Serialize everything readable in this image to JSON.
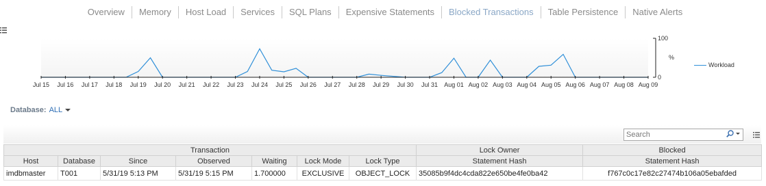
{
  "tabs": [
    {
      "label": "Overview",
      "active": false
    },
    {
      "label": "Memory",
      "active": false
    },
    {
      "label": "Host Load",
      "active": false
    },
    {
      "label": "Services",
      "active": false
    },
    {
      "label": "SQL Plans",
      "active": false
    },
    {
      "label": "Expensive Statements",
      "active": false
    },
    {
      "label": "Blocked Transactions",
      "active": true
    },
    {
      "label": "Table Persistence",
      "active": false
    },
    {
      "label": "Native Alerts",
      "active": false
    }
  ],
  "chart_data": {
    "type": "area",
    "categories": [
      "Jul 15",
      "Jul 16",
      "Jul 17",
      "Jul 18",
      "Jul 19",
      "Jul 20",
      "Jul 21",
      "Jul 22",
      "Jul 23",
      "Jul 24",
      "Jul 25",
      "Jul 26",
      "Jul 27",
      "Jul 28",
      "Jul 29",
      "Jul 30",
      "Jul 31",
      "Aug 01",
      "Aug 02",
      "Aug 03",
      "Aug 04",
      "Aug 05",
      "Aug 06",
      "Aug 07",
      "Aug 08",
      "Aug 09"
    ],
    "x": [
      0,
      1,
      2,
      3,
      3.5,
      4,
      4.5,
      5,
      6,
      7,
      8,
      8.5,
      9,
      9.5,
      10,
      10.5,
      11,
      12,
      13,
      13.5,
      14,
      15,
      15.5,
      16,
      16.5,
      17,
      17.5,
      18,
      18.5,
      19,
      20,
      20.5,
      21,
      21.5,
      22,
      23,
      24,
      25
    ],
    "values": [
      0,
      0,
      0,
      0,
      0,
      15,
      50,
      0,
      0,
      0,
      0,
      15,
      73,
      18,
      14,
      23,
      0,
      0,
      0,
      8,
      5,
      0,
      0,
      0,
      12,
      49,
      0,
      0,
      44,
      0,
      0,
      28,
      31,
      59,
      0,
      0,
      0,
      0
    ],
    "ylim": [
      0,
      100
    ],
    "yticks": [
      0,
      100
    ],
    "ylabel": "%",
    "series_name": "Workload",
    "color": "#2f8fd8",
    "fill_color": "#f4f4f4",
    "grid": false,
    "legend_position": "right"
  },
  "filter": {
    "label": "Database:",
    "value": "ALL"
  },
  "search": {
    "placeholder": "Search"
  },
  "table": {
    "group_headers": [
      "Transaction",
      "Lock Owner",
      "Blocked"
    ],
    "columns": [
      "Host",
      "Database",
      "Since",
      "Observed",
      "Waiting",
      "Lock Mode",
      "Lock Type",
      "Statement Hash",
      "Statement Hash"
    ],
    "rows": [
      [
        "imdbmaster",
        "T001",
        "5/31/19 5:13 PM",
        "5/31/19 5:15 PM",
        "1.700000",
        "EXCLUSIVE",
        "OBJECT_LOCK",
        "35085b9f4dc4cda822e650be4fe0ba42",
        "f767c0c17e82c27474b106a05ebafded"
      ]
    ]
  },
  "icons": {
    "chart_menu": "list-menu-icon",
    "search": "magnifier-icon",
    "grid_menu": "list-menu-icon"
  }
}
